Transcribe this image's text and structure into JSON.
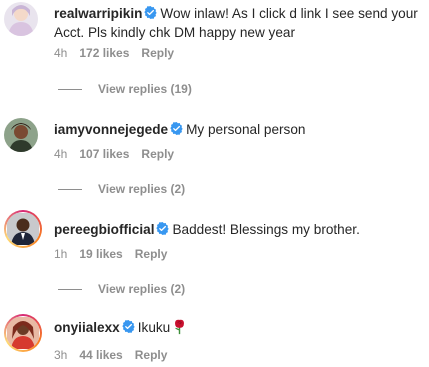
{
  "colors": {
    "verified": "#3897f0",
    "text": "#262626",
    "muted": "#8e8e8e"
  },
  "comments": [
    {
      "username": "realwarripikin",
      "text": "Wow inlaw! As I click d link I see send your Acct. Pls kindly chk DM happy new year",
      "time": "4h",
      "likes": "172 likes",
      "reply": "Reply",
      "view_replies": "View replies (19)"
    },
    {
      "username": "iamyvonnejegede",
      "text": "My personal person",
      "time": "4h",
      "likes": "107 likes",
      "reply": "Reply",
      "view_replies": "View replies (2)"
    },
    {
      "username": "pereegbiofficial",
      "text": "Baddest! Blessings my brother.",
      "time": "1h",
      "likes": "19 likes",
      "reply": "Reply",
      "view_replies": "View replies (2)"
    },
    {
      "username": "onyiialexx",
      "text": "Ikuku",
      "emoji": "rose-icon",
      "time": "3h",
      "likes": "44 likes",
      "reply": "Reply"
    }
  ]
}
